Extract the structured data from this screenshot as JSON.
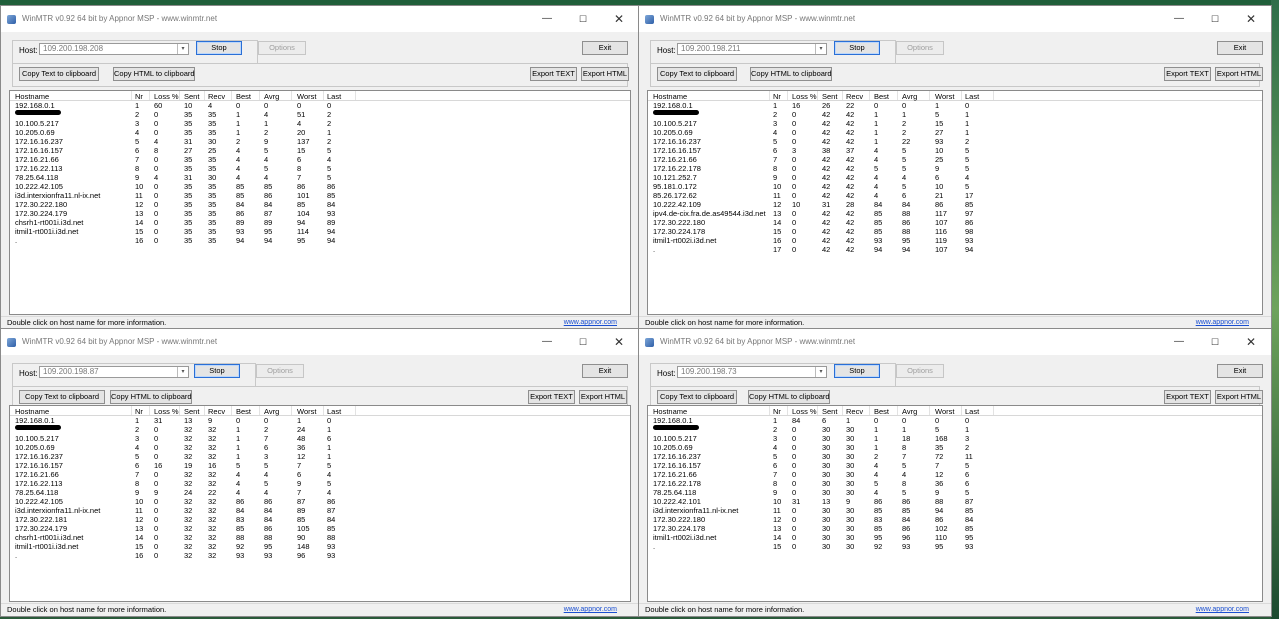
{
  "windows": [
    {
      "title": "WinMTR v0.92 64 bit by Appnor MSP - www.winmtr.net",
      "host_label": "Host:",
      "host_value": "109.200.198.208",
      "stop_label": "Stop",
      "options_label": "Options",
      "exit_label": "Exit",
      "copy_text_label": "Copy Text to clipboard",
      "copy_html_label": "Copy HTML to clipboard",
      "export_text_label": "Export TEXT",
      "export_html_label": "Export HTML",
      "columns": [
        "Hostname",
        "Nr",
        "Loss %",
        "Sent",
        "Recv",
        "Best",
        "Avrg",
        "Worst",
        "Last"
      ],
      "rows": [
        [
          "192.168.0.1",
          "1",
          "60",
          "10",
          "4",
          "0",
          "0",
          "0",
          "0"
        ],
        [
          "",
          "2",
          "0",
          "35",
          "35",
          "1",
          "4",
          "51",
          "2"
        ],
        [
          "10.100.5.217",
          "3",
          "0",
          "35",
          "35",
          "1",
          "1",
          "4",
          "2"
        ],
        [
          "10.205.0.69",
          "4",
          "0",
          "35",
          "35",
          "1",
          "2",
          "20",
          "1"
        ],
        [
          "172.16.16.237",
          "5",
          "4",
          "31",
          "30",
          "2",
          "9",
          "137",
          "2"
        ],
        [
          "172.16.16.157",
          "6",
          "8",
          "27",
          "25",
          "4",
          "5",
          "15",
          "5"
        ],
        [
          "172.16.21.66",
          "7",
          "0",
          "35",
          "35",
          "4",
          "4",
          "6",
          "4"
        ],
        [
          "172.16.22.113",
          "8",
          "0",
          "35",
          "35",
          "4",
          "5",
          "8",
          "5"
        ],
        [
          "78.25.64.118",
          "9",
          "4",
          "31",
          "30",
          "4",
          "4",
          "7",
          "5"
        ],
        [
          "10.222.42.105",
          "10",
          "0",
          "35",
          "35",
          "85",
          "85",
          "86",
          "86"
        ],
        [
          "i3d.interxionfra11.nl-ix.net",
          "11",
          "0",
          "35",
          "35",
          "85",
          "86",
          "101",
          "85"
        ],
        [
          "172.30.222.180",
          "12",
          "0",
          "35",
          "35",
          "84",
          "84",
          "85",
          "84"
        ],
        [
          "172.30.224.179",
          "13",
          "0",
          "35",
          "35",
          "86",
          "87",
          "104",
          "93"
        ],
        [
          "chsrh1-rt001i.i3d.net",
          "14",
          "0",
          "35",
          "35",
          "89",
          "89",
          "94",
          "89"
        ],
        [
          "itmil1-rt001i.i3d.net",
          "15",
          "0",
          "35",
          "35",
          "93",
          "95",
          "114",
          "94"
        ],
        [
          ".",
          "16",
          "0",
          "35",
          "35",
          "94",
          "94",
          "95",
          "94"
        ]
      ],
      "status": "Double click on host name for more information.",
      "link": "www.appnor.com"
    },
    {
      "title": "WinMTR v0.92 64 bit by Appnor MSP - www.winmtr.net",
      "host_label": "Host:",
      "host_value": "109.200.198.211",
      "stop_label": "Stop",
      "options_label": "Options",
      "exit_label": "Exit",
      "copy_text_label": "Copy Text to clipboard",
      "copy_html_label": "Copy HTML to clipboard",
      "export_text_label": "Export TEXT",
      "export_html_label": "Export HTML",
      "columns": [
        "Hostname",
        "Nr",
        "Loss %",
        "Sent",
        "Recv",
        "Best",
        "Avrg",
        "Worst",
        "Last"
      ],
      "rows": [
        [
          "192.168.0.1",
          "1",
          "16",
          "26",
          "22",
          "0",
          "0",
          "1",
          "0"
        ],
        [
          "",
          "2",
          "0",
          "42",
          "42",
          "1",
          "1",
          "5",
          "1"
        ],
        [
          "10.100.5.217",
          "3",
          "0",
          "42",
          "42",
          "1",
          "2",
          "15",
          "1"
        ],
        [
          "10.205.0.69",
          "4",
          "0",
          "42",
          "42",
          "1",
          "2",
          "27",
          "1"
        ],
        [
          "172.16.16.237",
          "5",
          "0",
          "42",
          "42",
          "1",
          "22",
          "93",
          "2"
        ],
        [
          "172.16.16.157",
          "6",
          "3",
          "38",
          "37",
          "4",
          "5",
          "10",
          "5"
        ],
        [
          "172.16.21.66",
          "7",
          "0",
          "42",
          "42",
          "4",
          "5",
          "25",
          "5"
        ],
        [
          "172.16.22.178",
          "8",
          "0",
          "42",
          "42",
          "5",
          "5",
          "9",
          "5"
        ],
        [
          "10.121.252.7",
          "9",
          "0",
          "42",
          "42",
          "4",
          "4",
          "6",
          "4"
        ],
        [
          "95.181.0.172",
          "10",
          "0",
          "42",
          "42",
          "4",
          "5",
          "10",
          "5"
        ],
        [
          "85.26.172.62",
          "11",
          "0",
          "42",
          "42",
          "4",
          "6",
          "21",
          "17"
        ],
        [
          "10.222.42.109",
          "12",
          "10",
          "31",
          "28",
          "84",
          "84",
          "86",
          "85"
        ],
        [
          "ipv4.de-cix.fra.de.as49544.i3d.net",
          "13",
          "0",
          "42",
          "42",
          "85",
          "88",
          "117",
          "97"
        ],
        [
          "172.30.222.180",
          "14",
          "0",
          "42",
          "42",
          "85",
          "86",
          "107",
          "86"
        ],
        [
          "172.30.224.178",
          "15",
          "0",
          "42",
          "42",
          "85",
          "88",
          "116",
          "98"
        ],
        [
          "itmil1-rt002i.i3d.net",
          "16",
          "0",
          "42",
          "42",
          "93",
          "95",
          "119",
          "93"
        ],
        [
          ".",
          "17",
          "0",
          "42",
          "42",
          "94",
          "94",
          "107",
          "94"
        ]
      ],
      "status": "Double click on host name for more information.",
      "link": "www.appnor.com"
    },
    {
      "title": "WinMTR v0.92 64 bit by Appnor MSP - www.winmtr.net",
      "host_label": "Host:",
      "host_value": "109.200.198.87",
      "stop_label": "Stop",
      "options_label": "Options",
      "exit_label": "Exit",
      "copy_text_label": "Copy Text to clipboard",
      "copy_html_label": "Copy HTML to clipboard",
      "export_text_label": "Export TEXT",
      "export_html_label": "Export HTML",
      "columns": [
        "Hostname",
        "Nr",
        "Loss %",
        "Sent",
        "Recv",
        "Best",
        "Avrg",
        "Worst",
        "Last"
      ],
      "rows": [
        [
          "192.168.0.1",
          "1",
          "31",
          "13",
          "9",
          "0",
          "0",
          "1",
          "0"
        ],
        [
          "",
          "2",
          "0",
          "32",
          "32",
          "1",
          "2",
          "24",
          "1"
        ],
        [
          "10.100.5.217",
          "3",
          "0",
          "32",
          "32",
          "1",
          "7",
          "48",
          "6"
        ],
        [
          "10.205.0.69",
          "4",
          "0",
          "32",
          "32",
          "1",
          "6",
          "36",
          "1"
        ],
        [
          "172.16.16.237",
          "5",
          "0",
          "32",
          "32",
          "1",
          "3",
          "12",
          "1"
        ],
        [
          "172.16.16.157",
          "6",
          "16",
          "19",
          "16",
          "5",
          "5",
          "7",
          "5"
        ],
        [
          "172.16.21.66",
          "7",
          "0",
          "32",
          "32",
          "4",
          "4",
          "6",
          "4"
        ],
        [
          "172.16.22.113",
          "8",
          "0",
          "32",
          "32",
          "4",
          "5",
          "9",
          "5"
        ],
        [
          "78.25.64.118",
          "9",
          "9",
          "24",
          "22",
          "4",
          "4",
          "7",
          "4"
        ],
        [
          "10.222.42.105",
          "10",
          "0",
          "32",
          "32",
          "86",
          "86",
          "87",
          "86"
        ],
        [
          "i3d.interxionfra11.nl-ix.net",
          "11",
          "0",
          "32",
          "32",
          "84",
          "84",
          "89",
          "87"
        ],
        [
          "172.30.222.181",
          "12",
          "0",
          "32",
          "32",
          "83",
          "84",
          "85",
          "84"
        ],
        [
          "172.30.224.179",
          "13",
          "0",
          "32",
          "32",
          "85",
          "86",
          "105",
          "85"
        ],
        [
          "chsrh1-rt001i.i3d.net",
          "14",
          "0",
          "32",
          "32",
          "88",
          "88",
          "90",
          "88"
        ],
        [
          "itmil1-rt001i.i3d.net",
          "15",
          "0",
          "32",
          "32",
          "92",
          "95",
          "148",
          "93"
        ],
        [
          ".",
          "16",
          "0",
          "32",
          "32",
          "93",
          "93",
          "96",
          "93"
        ]
      ],
      "status": "Double click on host name for more information.",
      "link": "www.appnor.com"
    },
    {
      "title": "WinMTR v0.92 64 bit by Appnor MSP - www.winmtr.net",
      "host_label": "Host:",
      "host_value": "109.200.198.73",
      "stop_label": "Stop",
      "options_label": "Options",
      "exit_label": "Exit",
      "copy_text_label": "Copy Text to clipboard",
      "copy_html_label": "Copy HTML to clipboard",
      "export_text_label": "Export TEXT",
      "export_html_label": "Export HTML",
      "columns": [
        "Hostname",
        "Nr",
        "Loss %",
        "Sent",
        "Recv",
        "Best",
        "Avrg",
        "Worst",
        "Last"
      ],
      "rows": [
        [
          "192.168.0.1",
          "1",
          "84",
          "6",
          "1",
          "0",
          "0",
          "0",
          "0"
        ],
        [
          "",
          "2",
          "0",
          "30",
          "30",
          "1",
          "1",
          "5",
          "1"
        ],
        [
          "10.100.5.217",
          "3",
          "0",
          "30",
          "30",
          "1",
          "18",
          "168",
          "3"
        ],
        [
          "10.205.0.69",
          "4",
          "0",
          "30",
          "30",
          "1",
          "8",
          "35",
          "2"
        ],
        [
          "172.16.16.237",
          "5",
          "0",
          "30",
          "30",
          "2",
          "7",
          "72",
          "11"
        ],
        [
          "172.16.16.157",
          "6",
          "0",
          "30",
          "30",
          "4",
          "5",
          "7",
          "5"
        ],
        [
          "172.16.21.66",
          "7",
          "0",
          "30",
          "30",
          "4",
          "4",
          "12",
          "6"
        ],
        [
          "172.16.22.178",
          "8",
          "0",
          "30",
          "30",
          "5",
          "8",
          "36",
          "6"
        ],
        [
          "78.25.64.118",
          "9",
          "0",
          "30",
          "30",
          "4",
          "5",
          "9",
          "5"
        ],
        [
          "10.222.42.101",
          "10",
          "31",
          "13",
          "9",
          "86",
          "86",
          "88",
          "87"
        ],
        [
          "i3d.interxionfra11.nl-ix.net",
          "11",
          "0",
          "30",
          "30",
          "85",
          "85",
          "94",
          "85"
        ],
        [
          "172.30.222.180",
          "12",
          "0",
          "30",
          "30",
          "83",
          "84",
          "86",
          "84"
        ],
        [
          "172.30.224.178",
          "13",
          "0",
          "30",
          "30",
          "85",
          "86",
          "102",
          "85"
        ],
        [
          "itmil1-rt002i.i3d.net",
          "14",
          "0",
          "30",
          "30",
          "95",
          "96",
          "110",
          "95"
        ],
        [
          ".",
          "15",
          "0",
          "30",
          "30",
          "92",
          "93",
          "95",
          "93"
        ]
      ],
      "status": "Double click on host name for more information.",
      "link": "www.appnor.com"
    }
  ]
}
